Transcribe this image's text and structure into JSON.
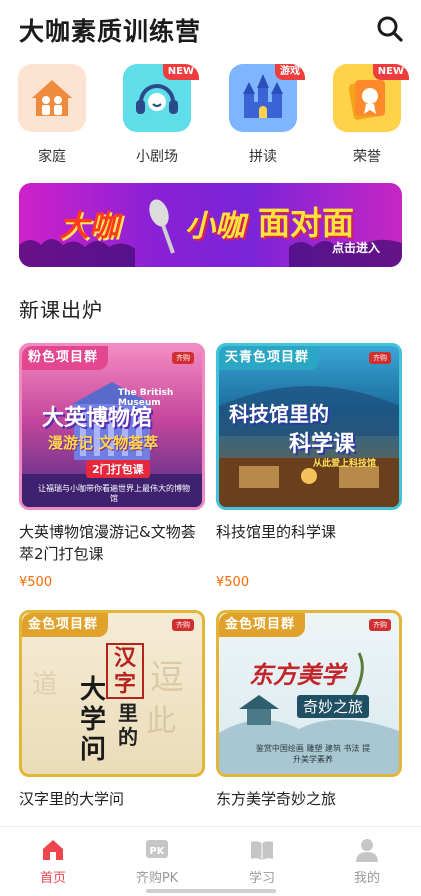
{
  "header": {
    "title": "大咖素质训练营",
    "search_icon": "search-icon"
  },
  "categories": [
    {
      "label": "家庭",
      "icon": "family-icon",
      "badge": "",
      "color": "#fde3d2"
    },
    {
      "label": "小剧场",
      "icon": "headset-icon",
      "badge": "NEW",
      "color": "#5fdde8"
    },
    {
      "label": "拼读",
      "icon": "castle-icon",
      "badge": "游戏",
      "color": "#7fb4ff"
    },
    {
      "label": "荣誉",
      "icon": "medal-icon",
      "badge": "NEW",
      "color": "#ffd24a"
    }
  ],
  "banner": {
    "part1": "大咖",
    "part2": "小咖",
    "part3": "面对面",
    "enter": "点击进入"
  },
  "section": {
    "title": "新课出炉"
  },
  "courses": [
    {
      "ribbon": "粉色项目群",
      "tagline": "齐购",
      "cover_title": "大英博物馆",
      "cover_sub": "漫游记 文物荟萃",
      "cover_extra": "2门打包课",
      "cover_en": "The British Museum",
      "cover_desc": "让福瑞与小咖带你看遍世界上最伟大的博物馆",
      "name": "大英博物馆漫游记&文物荟萃2门打包课",
      "price": "¥500"
    },
    {
      "ribbon": "天青色项目群",
      "tagline": "齐购",
      "cover_title": "科技馆里的",
      "cover_sub": "科学课",
      "cover_extra": "",
      "cover_en": "",
      "cover_desc": "从此爱上科技馆",
      "name": "科技馆里的科学课",
      "price": "¥500"
    },
    {
      "ribbon": "金色项目群",
      "tagline": "齐购",
      "cover_title": "汉字",
      "cover_sub": "里的",
      "cover_extra": "大学问",
      "cover_en": "",
      "cover_desc": "",
      "name": "汉字里的大学问",
      "price": ""
    },
    {
      "ribbon": "金色项目群",
      "tagline": "齐购",
      "cover_title": "东方美学",
      "cover_sub": "奇妙之旅",
      "cover_extra": "",
      "cover_en": "",
      "cover_desc": "鉴赏中国绘画 雕塑 建筑 书法 提升美学素养",
      "name": "东方美学奇妙之旅",
      "price": ""
    }
  ],
  "tabbar": [
    {
      "label": "首页",
      "icon": "home-icon",
      "active": true
    },
    {
      "label": "齐购PK",
      "icon": "pk-icon",
      "active": false
    },
    {
      "label": "学习",
      "icon": "book-icon",
      "active": false
    },
    {
      "label": "我的",
      "icon": "person-icon",
      "active": false
    }
  ],
  "colors": {
    "accent": "#f0454f",
    "price": "#ff6a00",
    "badge": "#ee3d3d"
  }
}
